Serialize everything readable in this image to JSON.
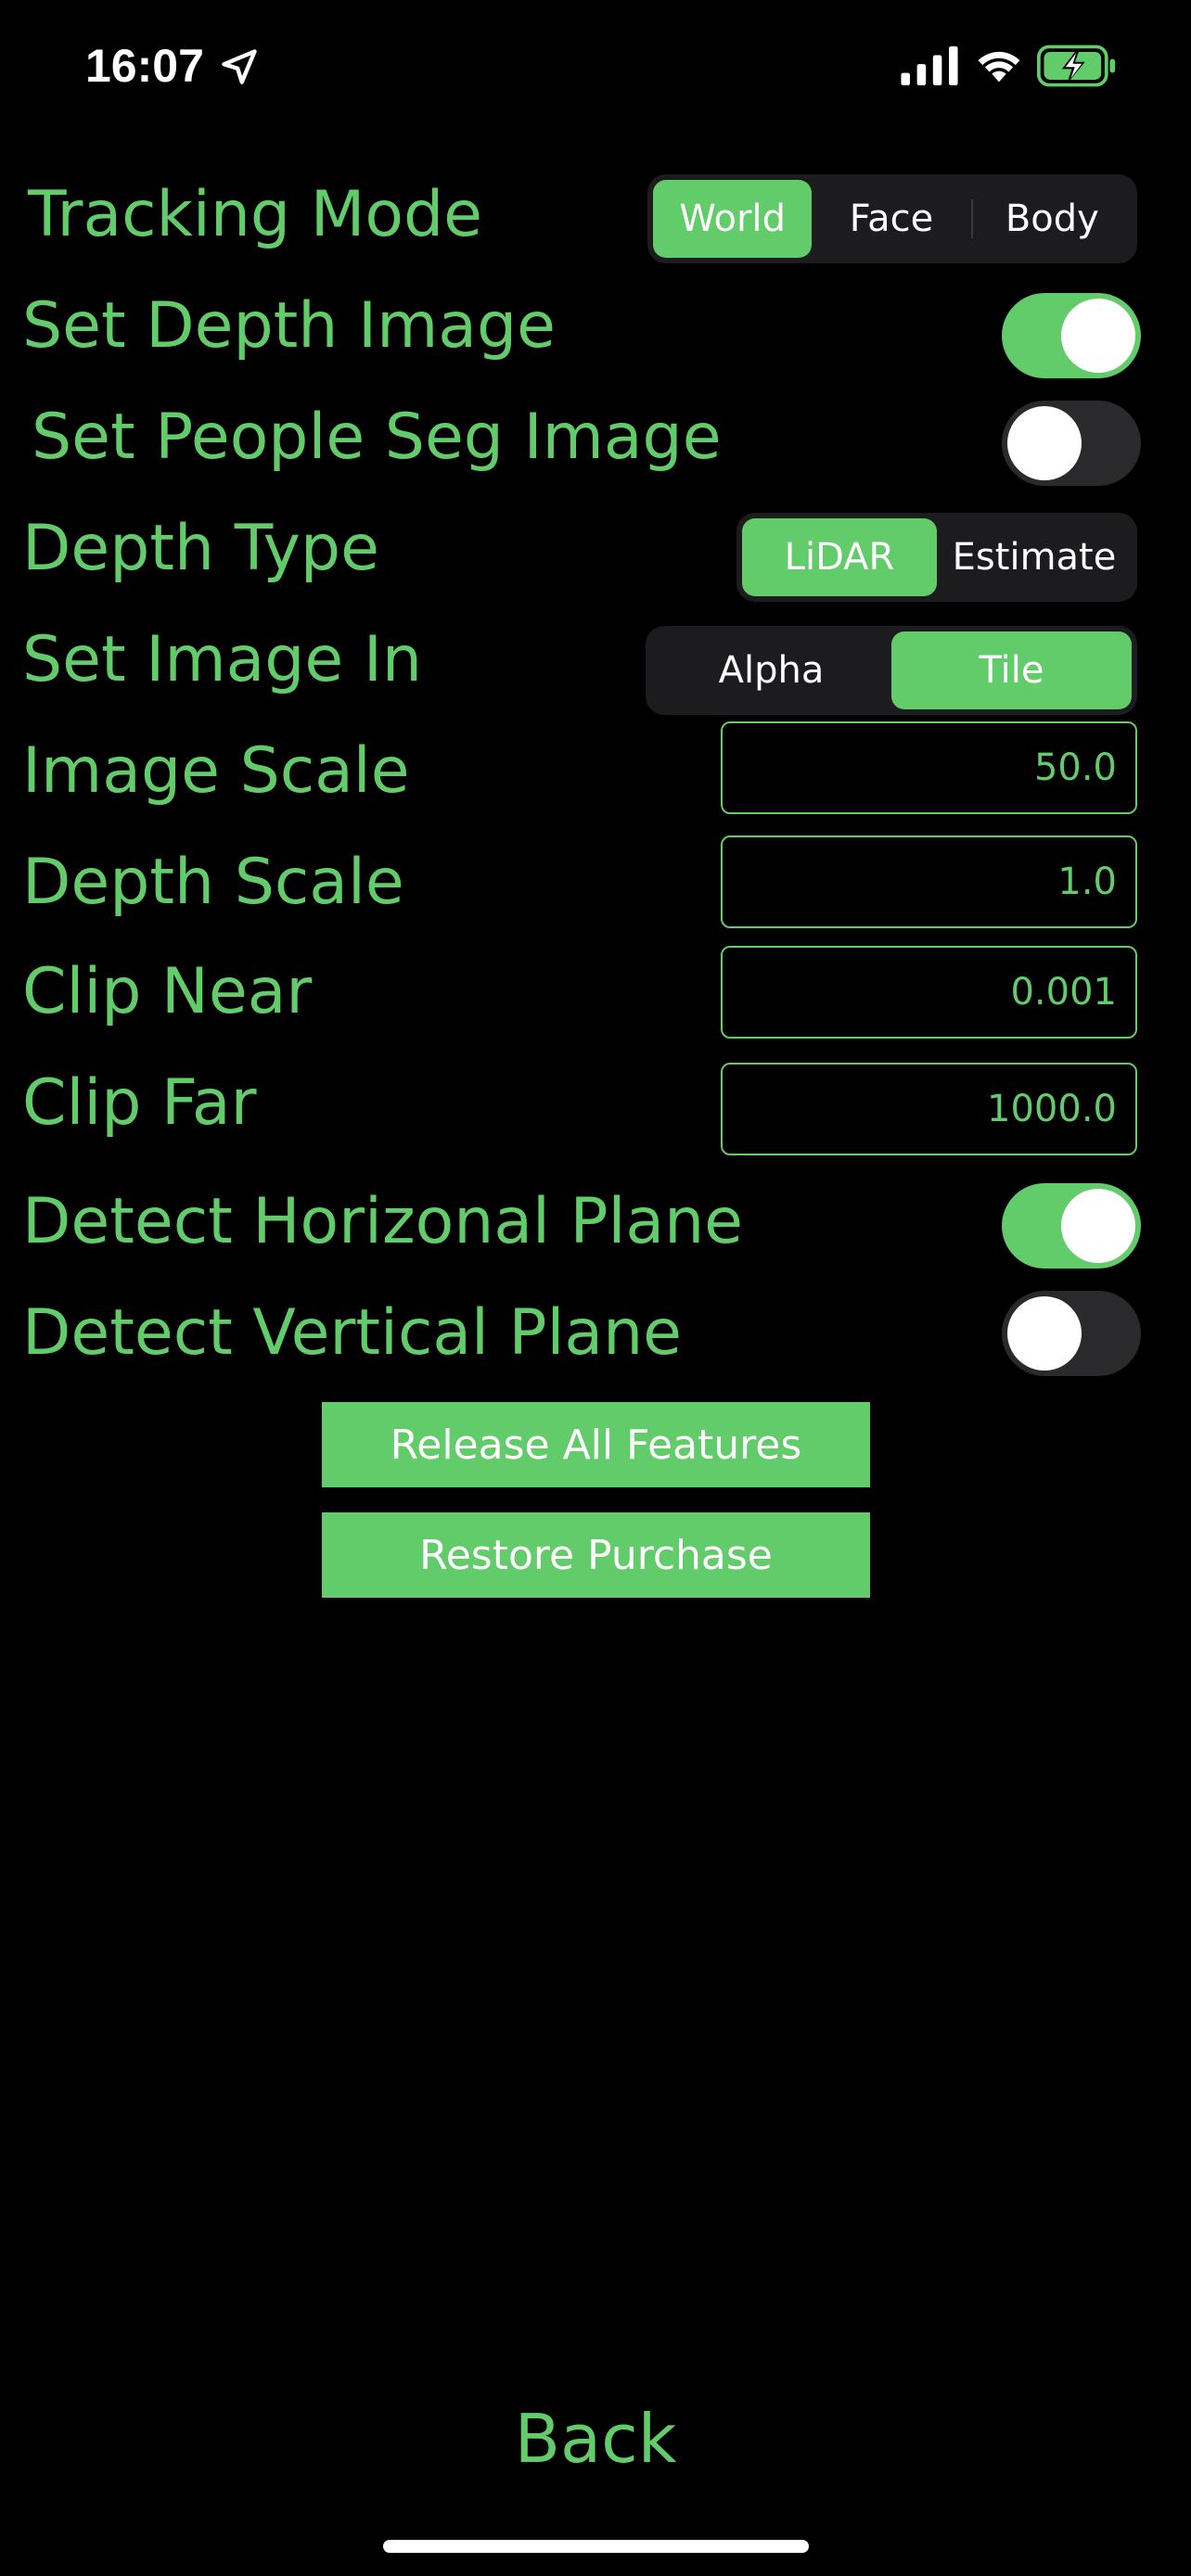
{
  "status_bar": {
    "time": "16:07",
    "icons": [
      "location-arrow-icon",
      "cellular-signal-icon",
      "wifi-icon",
      "battery-charging-icon"
    ]
  },
  "colors": {
    "accent": "#62cb6a",
    "background": "#000000",
    "segment_bg": "#1c1c1e",
    "toggle_off": "#2a2a2c"
  },
  "settings": {
    "tracking_mode": {
      "label": "Tracking Mode",
      "options": [
        "World",
        "Face",
        "Body"
      ],
      "selected": "World"
    },
    "set_depth_image": {
      "label": "Set Depth Image",
      "on": true
    },
    "set_people_seg_image": {
      "label": "Set People Seg Image",
      "on": false
    },
    "depth_type": {
      "label": "Depth Type",
      "options": [
        "LiDAR",
        "Estimate"
      ],
      "selected": "LiDAR"
    },
    "set_image_in": {
      "label": "Set Image In",
      "options": [
        "Alpha",
        "Tile"
      ],
      "selected": "Tile"
    },
    "image_scale": {
      "label": "Image Scale",
      "value": "50.0"
    },
    "depth_scale": {
      "label": "Depth Scale",
      "value": "1.0"
    },
    "clip_near": {
      "label": "Clip Near",
      "value": "0.001"
    },
    "clip_far": {
      "label": "Clip Far",
      "value": "1000.0"
    },
    "detect_horizontal_plane": {
      "label": "Detect Horizonal Plane",
      "on": true
    },
    "detect_vertical_plane": {
      "label": "Detect Vertical Plane",
      "on": false
    }
  },
  "buttons": {
    "release_all_features": "Release All Features",
    "restore_purchase": "Restore Purchase",
    "back": "Back"
  }
}
